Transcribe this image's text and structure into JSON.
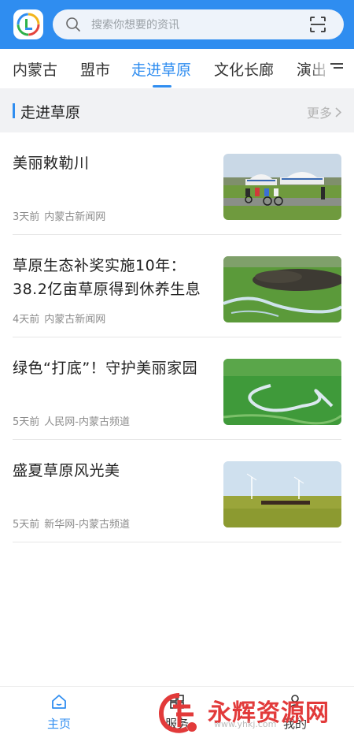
{
  "header": {
    "search_placeholder": "搜索你想要的资讯",
    "logo_icon": "app-logo-icon",
    "scan_icon": "scan-icon",
    "brand_color": "#2f8df0"
  },
  "tabs": [
    {
      "label": "内蒙古"
    },
    {
      "label": "盟市"
    },
    {
      "label": "走进草原",
      "active": true
    },
    {
      "label": "文化长廊"
    },
    {
      "label": "演出"
    }
  ],
  "section": {
    "title": "走进草原",
    "more_label": "更多"
  },
  "news": [
    {
      "title": "美丽敕勒川",
      "time": "3天前",
      "source": "内蒙古新闻网"
    },
    {
      "title": "草原生态补奖实施10年：38.2亿亩草原得到休养生息",
      "time": "4天前",
      "source": "内蒙古新闻网"
    },
    {
      "title": "绿色“打底”！守护美丽家园",
      "time": "5天前",
      "source": "人民网-内蒙古频道"
    },
    {
      "title": "盛夏草原风光美",
      "time": "5天前",
      "source": "新华网-内蒙古频道"
    }
  ],
  "bottom_nav": [
    {
      "label": "主页",
      "icon": "home-icon",
      "active": true
    },
    {
      "label": "服务",
      "icon": "service-icon"
    },
    {
      "label": "我的",
      "icon": "profile-icon"
    }
  ],
  "watermark": {
    "text": "永辉资源网",
    "url": "www.yhkj.com"
  }
}
